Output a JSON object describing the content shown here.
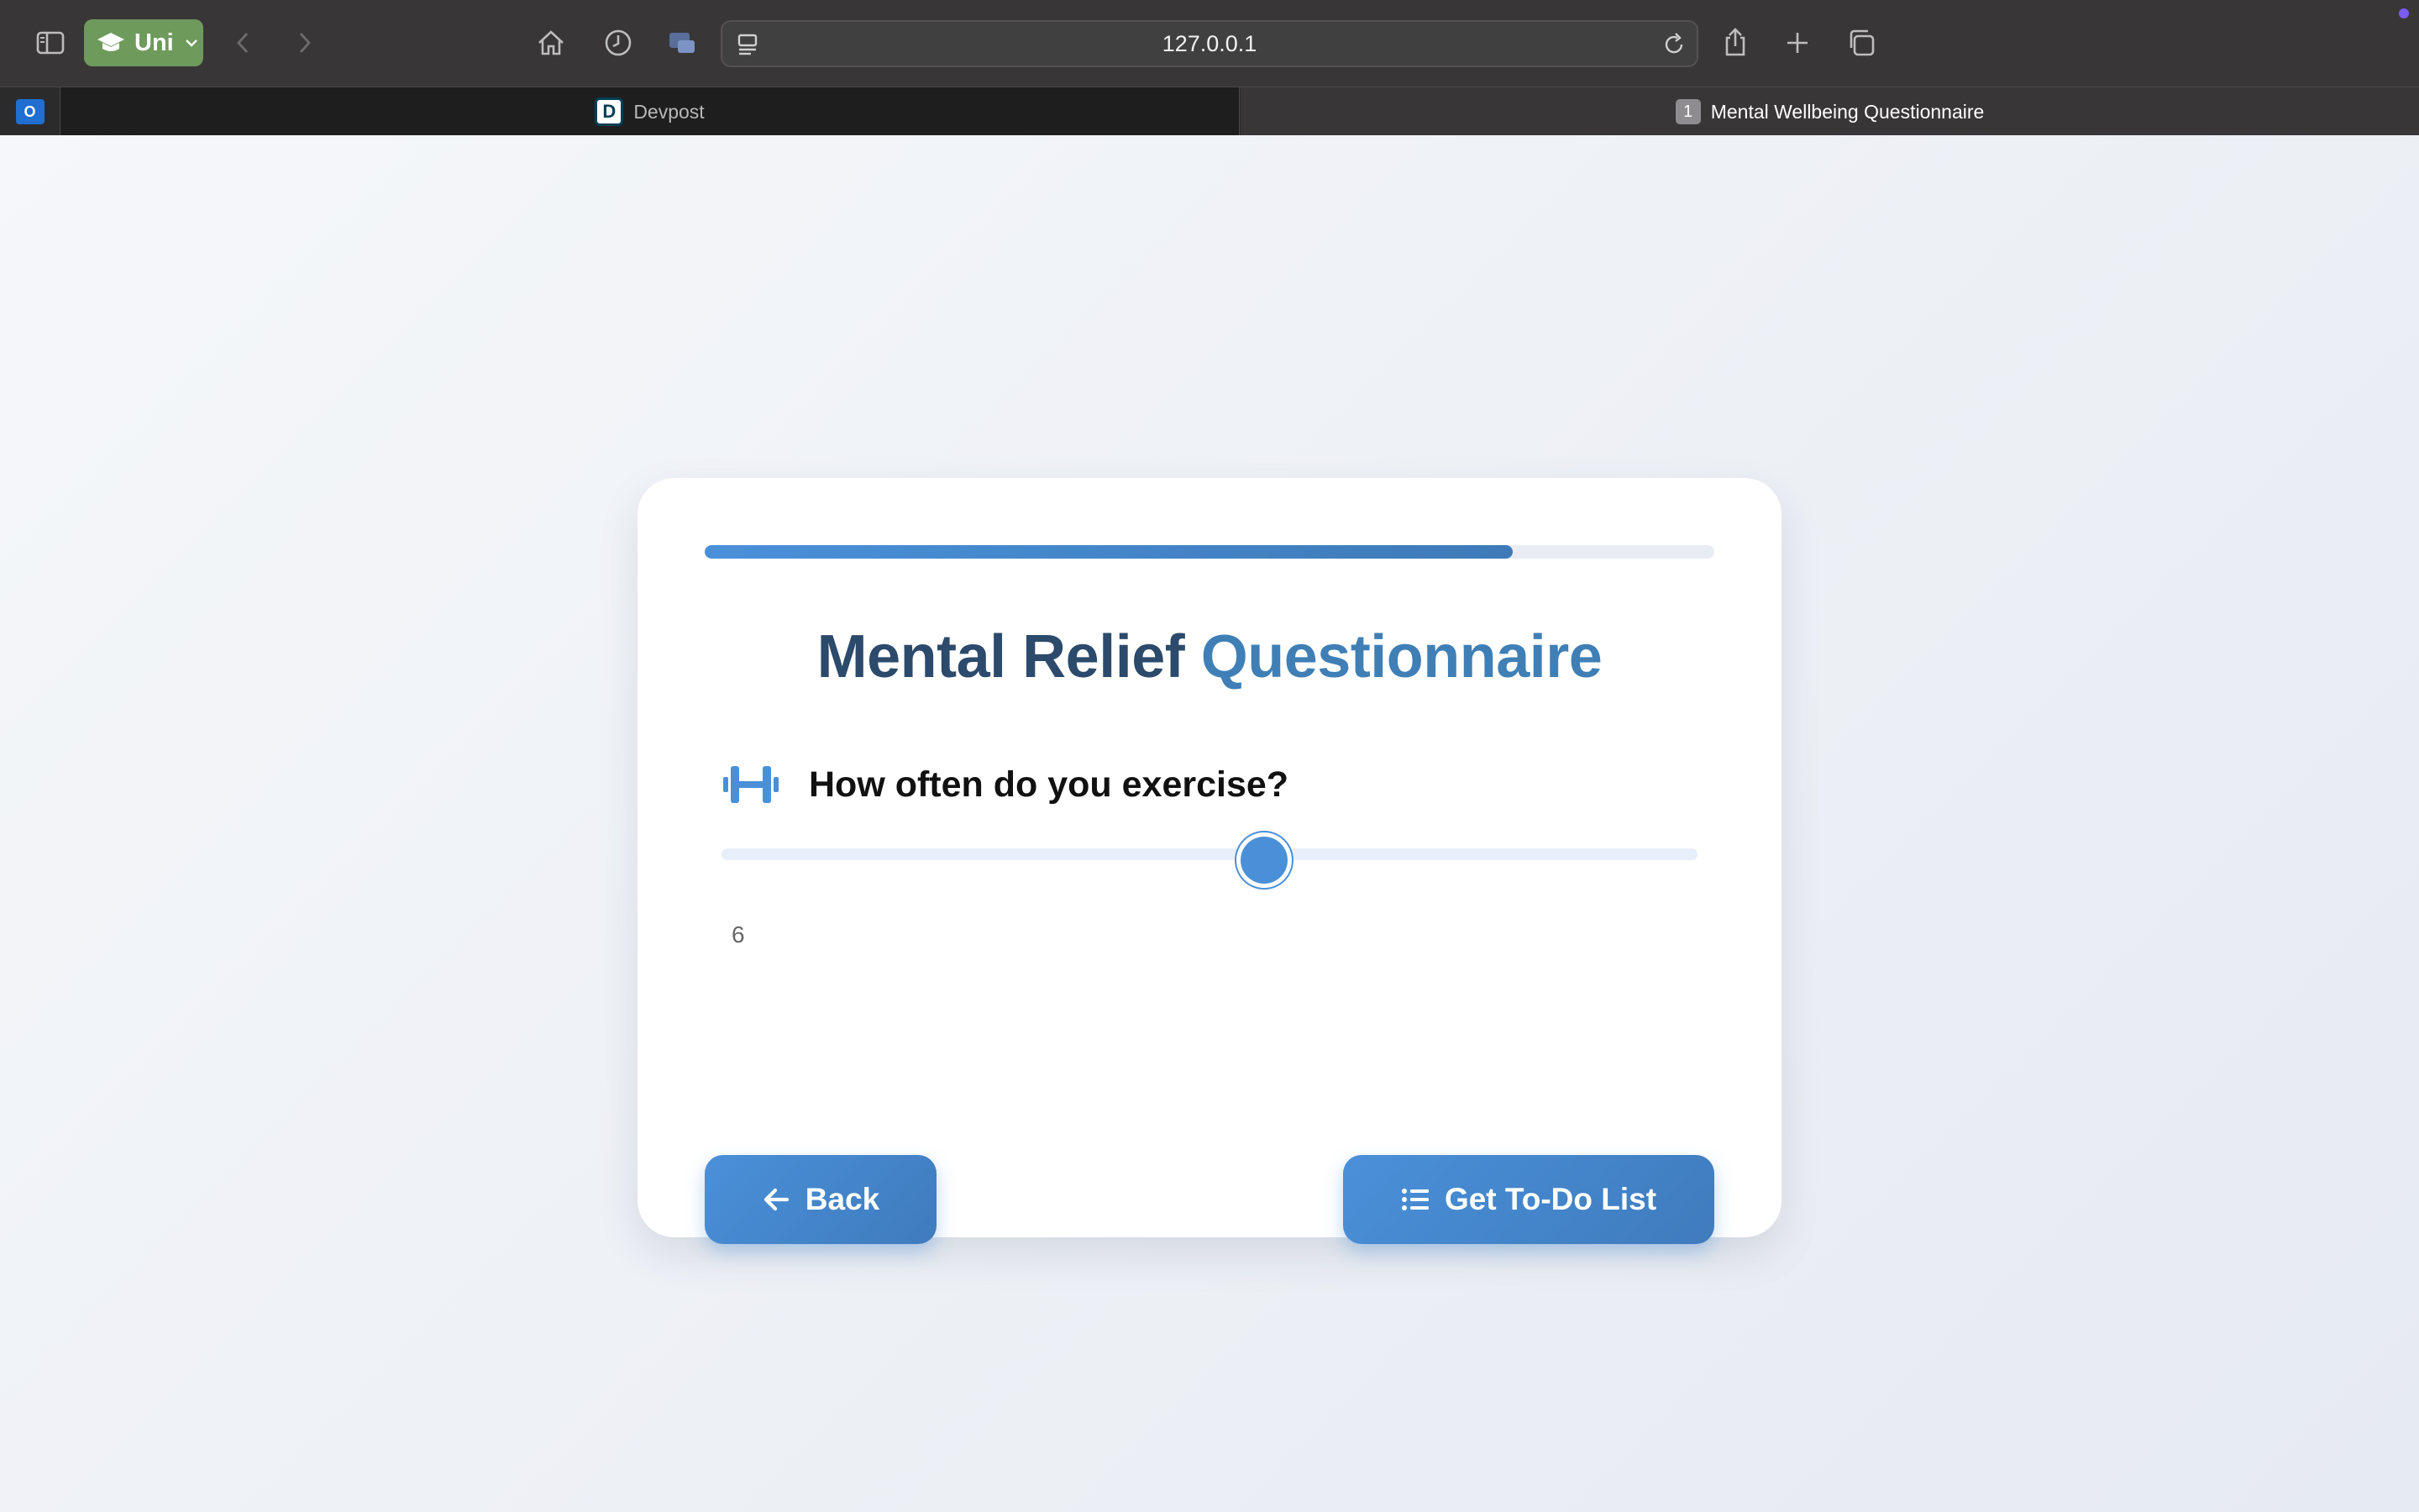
{
  "browser": {
    "profile_label": "Uni",
    "url": "127.0.0.1",
    "tabs": [
      {
        "label": "Devpost",
        "favicon_letter": "D",
        "active": false
      },
      {
        "label": "Mental Wellbeing Questionnaire",
        "favicon_letter": "1",
        "active": true
      }
    ],
    "pinned_tab_icon": "outlook-icon",
    "pinned_tab_letter": "O"
  },
  "card": {
    "progress_fraction": 0.8,
    "title_part1": "Mental Relief",
    "title_part2": "Questionnaire",
    "question_icon": "dumbbell-icon",
    "question": "How often do you exercise?",
    "slider": {
      "min": 1,
      "max": 10,
      "value": 6,
      "value_label": "6"
    },
    "back_label": "Back",
    "todo_label": "Get To-Do List"
  },
  "colors": {
    "accent": "#4a90d9",
    "title_dark": "#2c4a6b",
    "title_light": "#3f7fb6",
    "profile_green": "#6e9a5c"
  }
}
